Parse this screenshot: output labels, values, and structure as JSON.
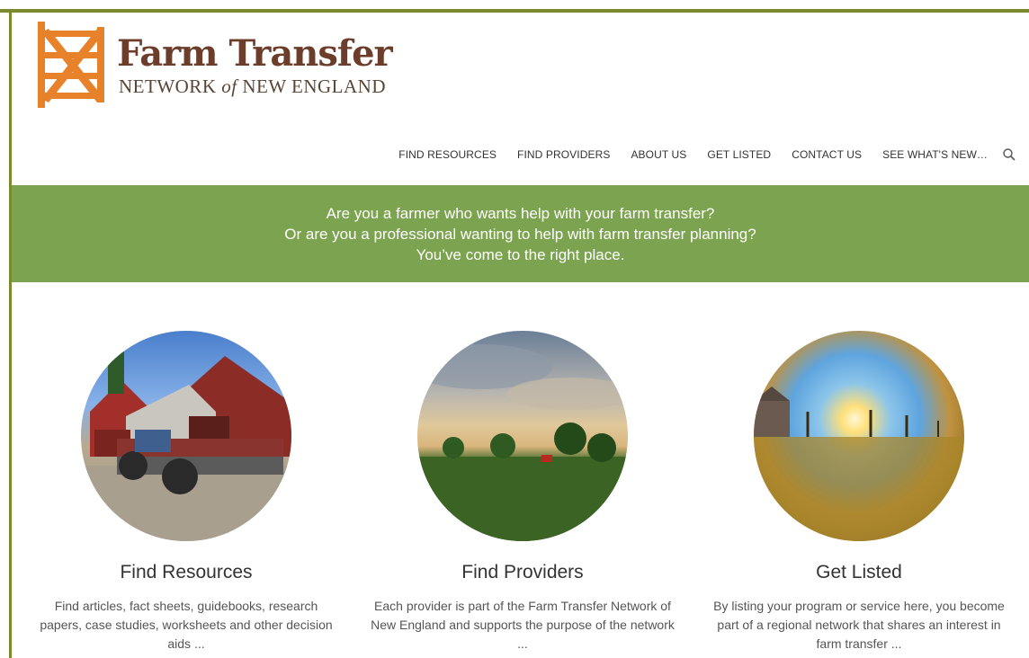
{
  "brand": {
    "title": "Farm Transfer",
    "subtitle_a": "NETWORK ",
    "subtitle_of": "of",
    "subtitle_b": " NEW ENGLAND",
    "colors": {
      "brown": "#6b3d2a",
      "orange": "#e8822a",
      "green": "#7ca34f",
      "frame": "#7a8a2c"
    }
  },
  "nav": {
    "items": [
      "FIND RESOURCES",
      "FIND PROVIDERS",
      "ABOUT US",
      "GET LISTED",
      "CONTACT US",
      "SEE WHAT'S NEW…"
    ],
    "search_icon": "search-icon"
  },
  "banner": {
    "line1": "Are you a farmer who wants help with your farm transfer?",
    "line2": "Or are you a professional wanting to help with farm transfer planning?",
    "line3": "You’ve come to the right place."
  },
  "cards": [
    {
      "title": "Find Resources",
      "text": "Find articles, fact sheets, guidebooks, research papers, case studies, worksheets and other decision aids ..."
    },
    {
      "title": "Find Providers",
      "text": "Each provider is part of the Farm Transfer Network of New England and supports the purpose of the network ..."
    },
    {
      "title": "Get Listed",
      "text": "By listing your program or service here, you become part of a regional network that shares an interest in farm transfer ..."
    }
  ]
}
